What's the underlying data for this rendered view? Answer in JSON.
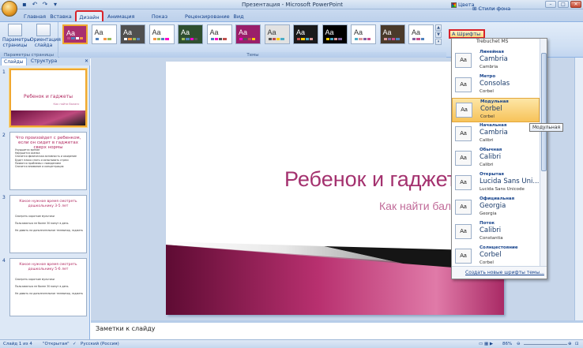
{
  "app": {
    "window_title": "Презентация - Microsoft PowerPoint"
  },
  "tabs": [
    {
      "label": "Главная"
    },
    {
      "label": "Вставка"
    },
    {
      "label": "Дизайн"
    },
    {
      "label": "Анимация"
    },
    {
      "label": "Показ слайдов"
    },
    {
      "label": "Рецензирование"
    },
    {
      "label": "Вид"
    }
  ],
  "ribbon": {
    "page_setup_label": "Параметры страницы",
    "orientation_label": "Ориентация слайда",
    "page_setup_group": "Параметры страницы",
    "themes_group": "Темы",
    "thumb_label": "Aa",
    "colors_label": "Цвета",
    "bg_styles_label": "Стили фона",
    "fonts_label": "Шрифты",
    "theme_colors": [
      "#a8306f",
      "#ffffff",
      "#4f4f4f",
      "#ffffff",
      "#2f4f2f",
      "#ffffff",
      "#9a1f6a",
      "#e2e2e2",
      "#1a1a1a",
      "#000000",
      "#ffffff",
      "#4a3a2a",
      "#ffffff"
    ],
    "scroll_up": "▲",
    "scroll_down": "▼",
    "scroll_more": "▾"
  },
  "left_pane": {
    "tab_slides": "Слайды",
    "tab_outline": "Структура",
    "slides": [
      {
        "num": "1",
        "title": "Ребенок и гаджеты",
        "subtitle": "Как найти баланс"
      },
      {
        "num": "2",
        "title": "Что произойдет с ребенком, если он сидит в гаджетах сверх нормы",
        "bullets": [
          "Ухудшится зрение",
          "Нарушится осанка",
          "Снизится физическая активность и ожирение",
          "Будет плохо спать и испытывать стресс",
          "Появятся проблемы с поведением",
          "Снизится внимание и концентрация"
        ]
      },
      {
        "num": "3",
        "title": "Какое нужное время смотреть дошкольнику 3-5 лет",
        "bullets": [
          "Смотреть короткие мультики",
          "Пользоваться не более 30 минут в день",
          "Не давать на дополнительное телевизор, гаджеты и компьютерные устройства"
        ]
      },
      {
        "num": "4",
        "title": "Какое нужное время смотреть дошкольнику 5-6 лет",
        "bullets": [
          "Смотреть короткие мультики",
          "Пользоваться не более 30 минут в день",
          "Не давать на дополнительное телевизор, гаджеты и компьютерные устройства"
        ]
      }
    ]
  },
  "slide": {
    "title": "Ребенок и гаджет",
    "subtitle": "Как найти бал"
  },
  "notes": {
    "placeholder": "Заметки к слайду"
  },
  "status": {
    "slide_info": "Слайд 1 из 4",
    "theme": "\"Открытая\"",
    "language": "Русский (Россия)",
    "zoom": "86%"
  },
  "fonts_dropdown": {
    "top_partial": "Trebuchet MS",
    "items": [
      {
        "name": "Линейная",
        "heading": "Cambria",
        "body": "Cambria"
      },
      {
        "name": "Метро",
        "heading": "Consolas",
        "body": "Corbel"
      },
      {
        "name": "Модульная",
        "heading": "Corbel",
        "body": "Corbel",
        "selected": true
      },
      {
        "name": "Начальная",
        "heading": "Cambria",
        "body": "Calibri"
      },
      {
        "name": "Обычная",
        "heading": "Calibri",
        "body": "Calibri"
      },
      {
        "name": "Открытая",
        "heading": "Lucida Sans Uni...",
        "body": "Lucida Sans Unicode"
      },
      {
        "name": "Официальная",
        "heading": "Georgia",
        "body": "Georgia"
      },
      {
        "name": "Поток",
        "heading": "Calibri",
        "body": "Constantia"
      },
      {
        "name": "Солнцестояние",
        "heading": "Corbel",
        "body": "Corbel"
      }
    ],
    "create_link": "Создать новые шрифты темы...",
    "tooltip": "Модульная"
  }
}
